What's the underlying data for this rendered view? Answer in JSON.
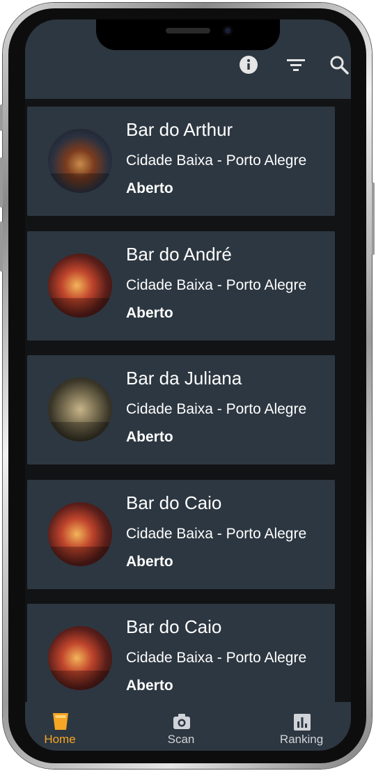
{
  "appbar": {
    "icons": [
      "info-icon",
      "filter-icon",
      "search-icon"
    ]
  },
  "bars": [
    {
      "name": "Bar do Arthur",
      "location": "Cidade Baixa - Porto Alegre",
      "status": "Aberto",
      "thumbnail": "bar-interior-photo-blue"
    },
    {
      "name": "Bar do André",
      "location": "Cidade Baixa - Porto Alegre",
      "status": "Aberto",
      "thumbnail": "bar-interior-photo-red"
    },
    {
      "name": "Bar da Juliana",
      "location": "Cidade Baixa - Porto Alegre",
      "status": "Aberto",
      "thumbnail": "bar-interior-photo-warm"
    },
    {
      "name": "Bar do Caio",
      "location": "Cidade Baixa - Porto Alegre",
      "status": "Aberto",
      "thumbnail": "bar-interior-photo-red"
    },
    {
      "name": "Bar do Caio",
      "location": "Cidade Baixa - Porto Alegre",
      "status": "Aberto",
      "thumbnail": "bar-interior-photo-red"
    }
  ],
  "bottom_nav": {
    "items": [
      {
        "label": "Home",
        "icon": "beer-glass-icon",
        "active": true
      },
      {
        "label": "Scan",
        "icon": "camera-icon",
        "active": false
      },
      {
        "label": "Ranking",
        "icon": "bar-chart-icon",
        "active": false
      }
    ]
  },
  "colors": {
    "surface": "#2d3741",
    "background": "#111314",
    "active": "#f5a623",
    "inactive": "#d0d4d8",
    "text": "#ffffff"
  }
}
